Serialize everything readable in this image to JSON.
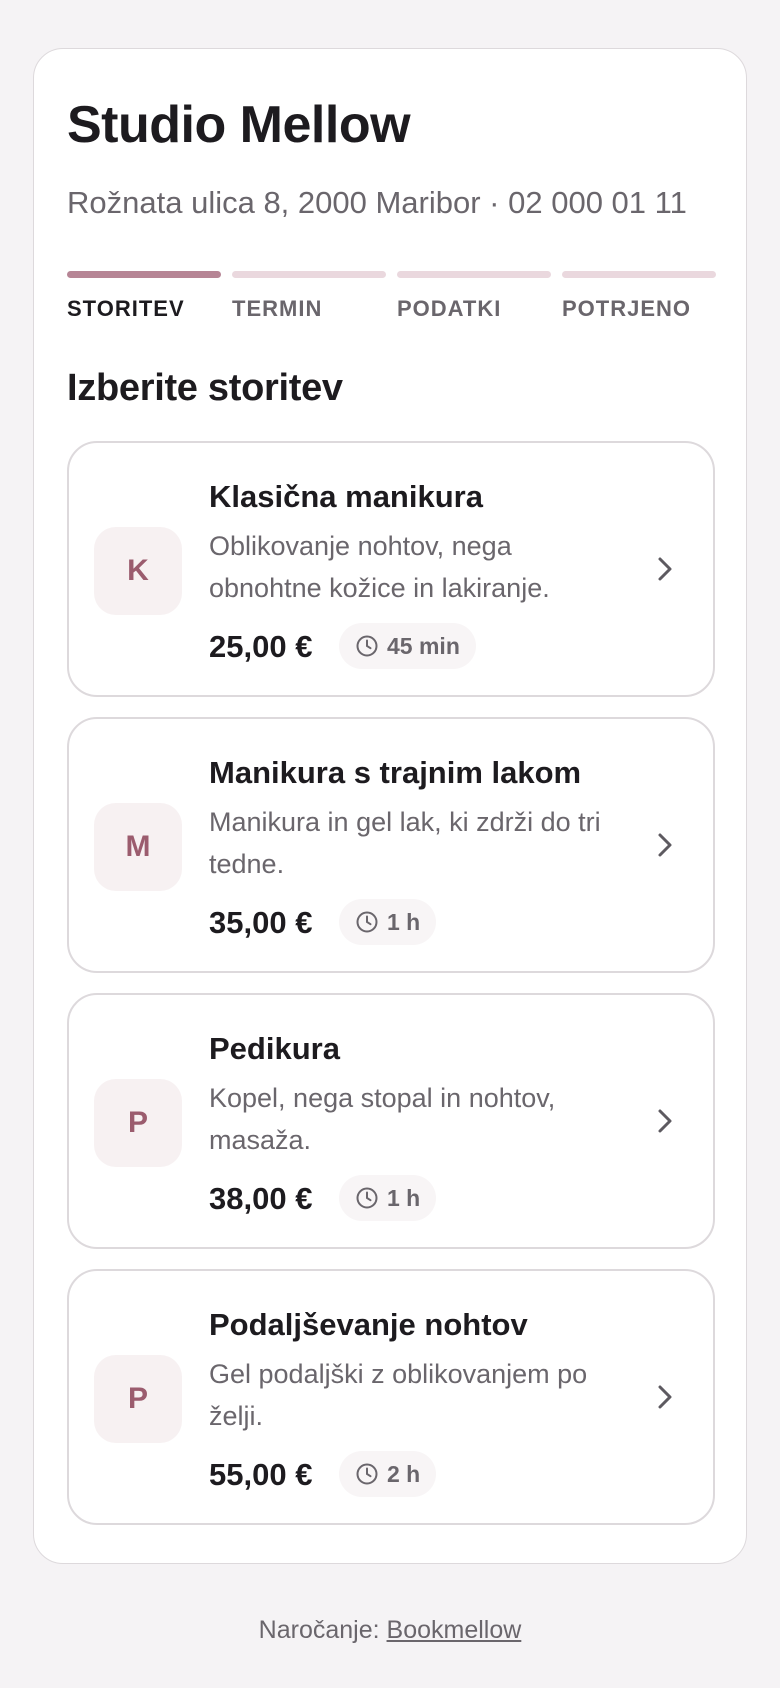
{
  "salon": {
    "name": "Studio Mellow",
    "address_phone": "Rožnata ulica 8, 2000 Maribor · 02 000 01 11"
  },
  "steps": [
    {
      "label": "STORITEV",
      "active": true
    },
    {
      "label": "TERMIN",
      "active": false
    },
    {
      "label": "PODATKI",
      "active": false
    },
    {
      "label": "POTRJENO",
      "active": false
    }
  ],
  "section_title": "Izberite storitev",
  "services": [
    {
      "initial": "K",
      "name": "Klasična manikura",
      "description": "Oblikovanje nohtov, nega obnohtne kožice in lakiranje.",
      "price": "25,00 €",
      "duration": "45 min"
    },
    {
      "initial": "M",
      "name": "Manikura s trajnim lakom",
      "description": "Manikura in gel lak, ki zdrži do tri tedne.",
      "price": "35,00 €",
      "duration": "1 h"
    },
    {
      "initial": "P",
      "name": "Pedikura",
      "description": "Kopel, nega stopal in nohtov, masaža.",
      "price": "38,00 €",
      "duration": "1 h"
    },
    {
      "initial": "P",
      "name": "Podaljševanje nohtov",
      "description": "Gel podaljški z oblikovanjem po želji.",
      "price": "55,00 €",
      "duration": "2 h"
    }
  ],
  "footer": {
    "prefix": "Naročanje:",
    "link_label": "Bookmellow"
  },
  "colors": {
    "accent": "#b68595",
    "accent_text": "#9b5c6e",
    "step_inactive": "#ead8de",
    "background": "#f5f3f5"
  },
  "icons": {
    "duration": "clock-icon",
    "row_action": "chevron-right-icon"
  }
}
